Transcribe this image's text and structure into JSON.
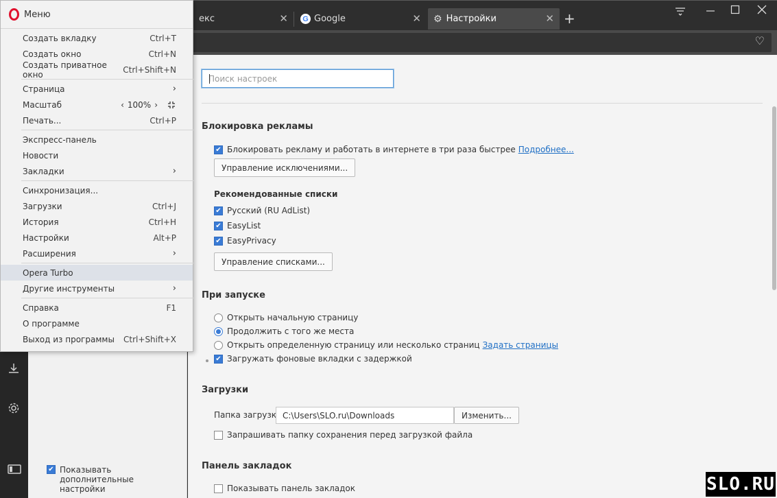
{
  "tabs": [
    {
      "label": "екс"
    },
    {
      "label": "Google"
    },
    {
      "label": "Настройки"
    }
  ],
  "new_tab_symbol": "+",
  "menu": {
    "title": "Меню",
    "items": [
      {
        "label": "Создать вкладку",
        "shortcut": "Ctrl+T"
      },
      {
        "label": "Создать окно",
        "shortcut": "Ctrl+N"
      },
      {
        "label": "Создать приватное окно",
        "shortcut": "Ctrl+Shift+N"
      },
      {
        "label": "Страница",
        "submenu": true
      },
      {
        "label": "Масштаб",
        "zoom": "100%"
      },
      {
        "label": "Печать...",
        "shortcut": "Ctrl+P"
      },
      {
        "label": "Экспресс-панель"
      },
      {
        "label": "Новости"
      },
      {
        "label": "Закладки",
        "submenu": true
      },
      {
        "label": "Синхронизация..."
      },
      {
        "label": "Загрузки",
        "shortcut": "Ctrl+J"
      },
      {
        "label": "История",
        "shortcut": "Ctrl+H"
      },
      {
        "label": "Настройки",
        "shortcut": "Alt+P"
      },
      {
        "label": "Расширения",
        "submenu": true
      },
      {
        "label": "Opera Turbo",
        "highlighted": true
      },
      {
        "label": "Другие инструменты",
        "submenu": true
      },
      {
        "label": "Справка",
        "shortcut": "F1"
      },
      {
        "label": "О программе"
      },
      {
        "label": "Выход из программы",
        "shortcut": "Ctrl+Shift+X"
      }
    ]
  },
  "leftnav": {
    "show_advanced_label": "Показывать дополнительные настройки",
    "show_advanced_checked": true
  },
  "settings": {
    "search_placeholder": "Поиск настроек",
    "adblock": {
      "title": "Блокировка рекламы",
      "block_label": "Блокировать рекламу и работать в интернете в три раза быстрее",
      "block_link": "Подробнее...",
      "exceptions_button": "Управление исключениями...",
      "lists_title": "Рекомендованные списки",
      "lists": [
        {
          "label": "Русский (RU AdList)",
          "checked": true
        },
        {
          "label": "EasyList",
          "checked": true
        },
        {
          "label": "EasyPrivacy",
          "checked": true
        }
      ],
      "manage_lists_button": "Управление списками..."
    },
    "startup": {
      "title": "При запуске",
      "options": [
        {
          "label": "Открыть начальную страницу",
          "selected": false
        },
        {
          "label": "Продолжить с того же места",
          "selected": true
        },
        {
          "label": "Открыть определенную страницу или несколько страниц",
          "selected": false,
          "link": "Задать страницы"
        }
      ],
      "delay_label": "Загружать фоновые вкладки с задержкой",
      "delay_checked": true
    },
    "downloads": {
      "title": "Загрузки",
      "folder_label": "Папка загрузки:",
      "folder_value": "C:\\Users\\SLO.ru\\Downloads",
      "change_button": "Изменить...",
      "ask_label": "Запрашивать папку сохранения перед загрузкой файла",
      "ask_checked": false
    },
    "bookmarks_bar": {
      "title": "Панель закладок",
      "show_label": "Показывать панель закладок",
      "show_checked": false
    }
  },
  "watermark": "SLO.RU",
  "colors": {
    "accent": "#3a7bd5",
    "opera_red": "#e0102d",
    "link": "#1f6fc5"
  }
}
